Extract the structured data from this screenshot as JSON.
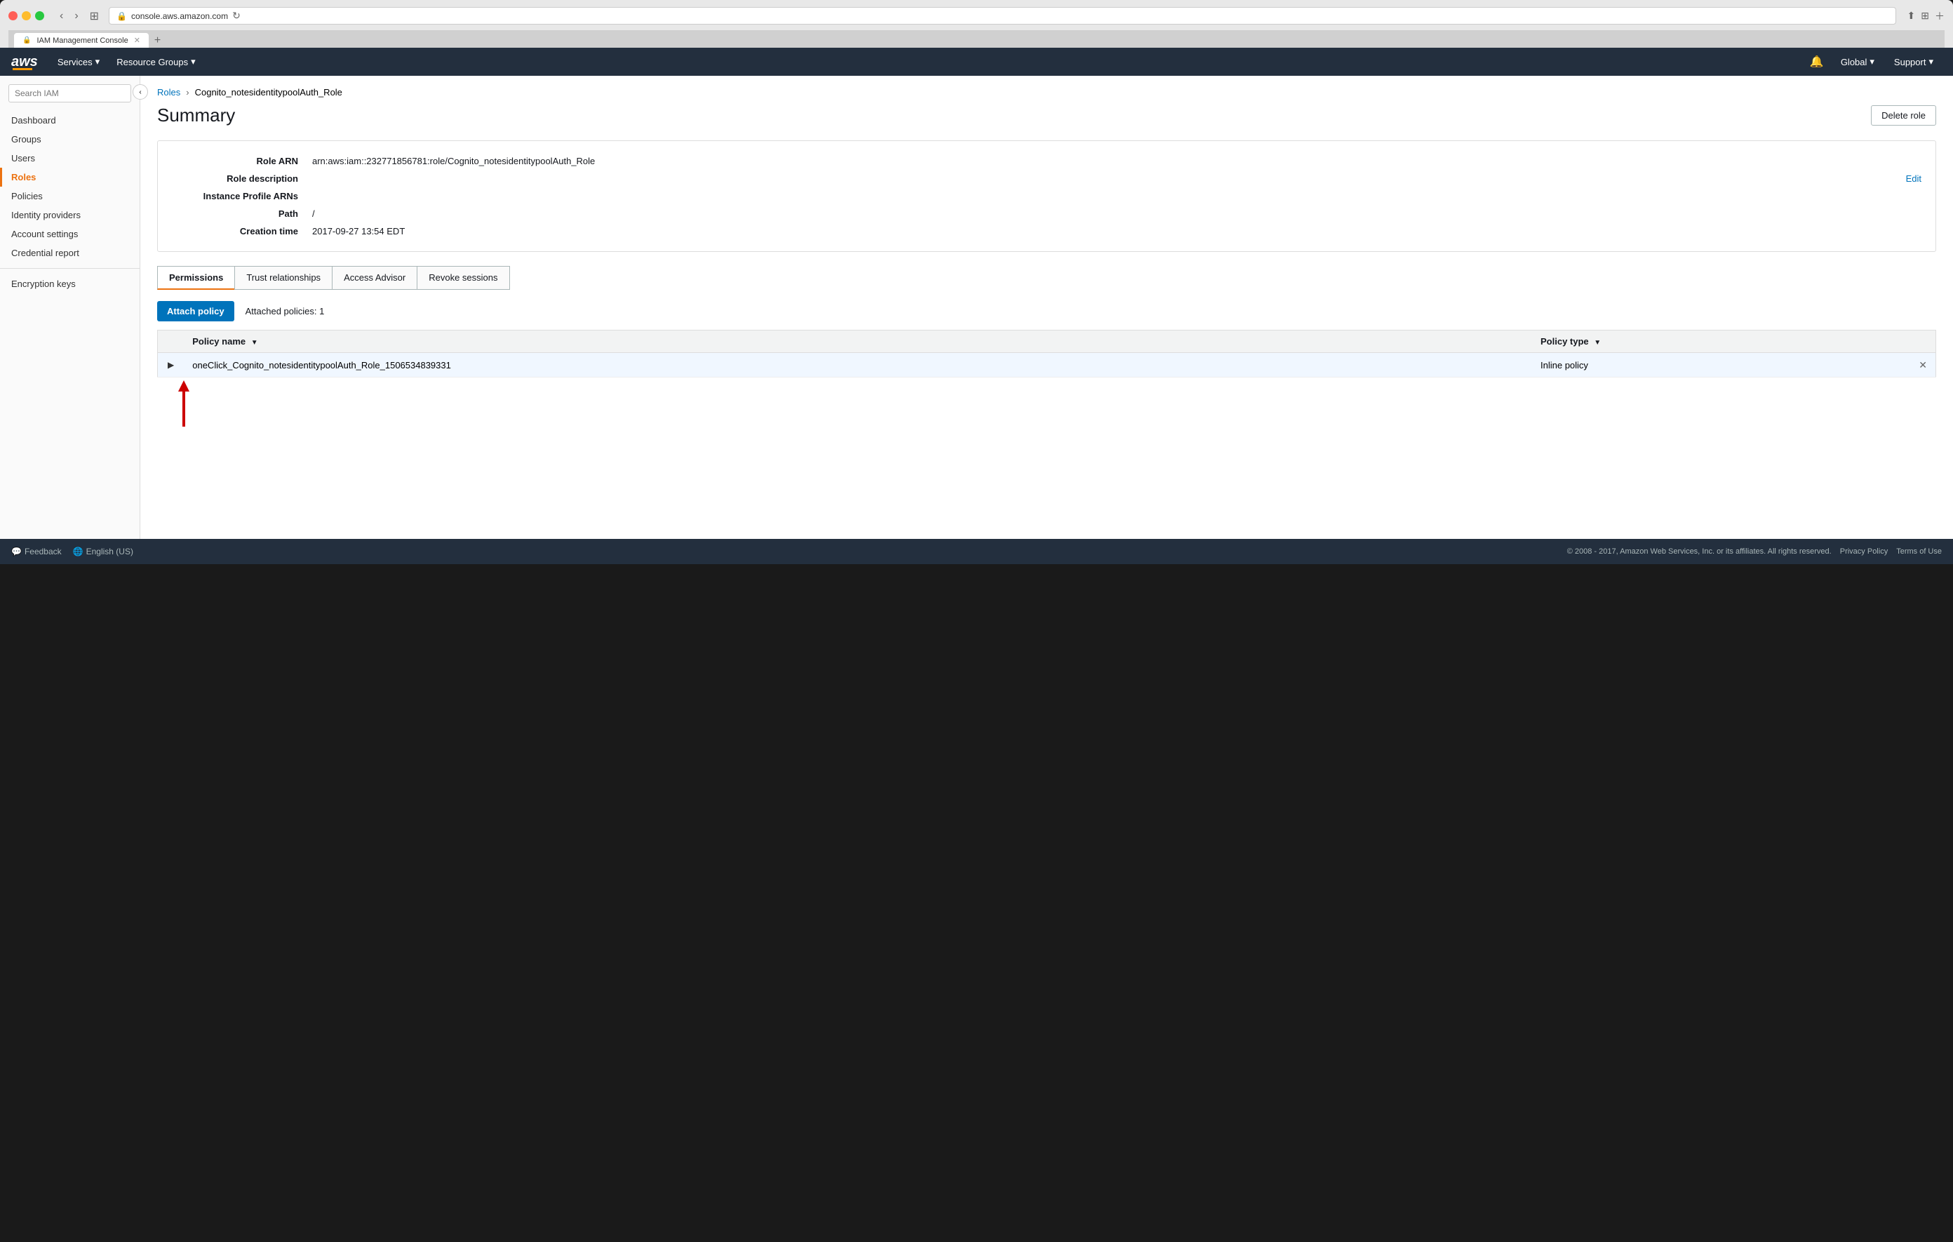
{
  "browser": {
    "url": "console.aws.amazon.com",
    "tab_title": "IAM Management Console",
    "tab_icon": "🔒"
  },
  "aws_nav": {
    "logo": "aws",
    "logo_underline_color": "#ff9900",
    "services_label": "Services",
    "resource_groups_label": "Resource Groups",
    "global_label": "Global",
    "support_label": "Support"
  },
  "sidebar": {
    "search_placeholder": "Search IAM",
    "items": [
      {
        "id": "dashboard",
        "label": "Dashboard",
        "active": false
      },
      {
        "id": "groups",
        "label": "Groups",
        "active": false
      },
      {
        "id": "users",
        "label": "Users",
        "active": false
      },
      {
        "id": "roles",
        "label": "Roles",
        "active": true
      },
      {
        "id": "policies",
        "label": "Policies",
        "active": false
      },
      {
        "id": "identity-providers",
        "label": "Identity providers",
        "active": false
      },
      {
        "id": "account-settings",
        "label": "Account settings",
        "active": false
      },
      {
        "id": "credential-report",
        "label": "Credential report",
        "active": false
      }
    ],
    "bottom_items": [
      {
        "id": "encryption-keys",
        "label": "Encryption keys",
        "active": false
      }
    ]
  },
  "breadcrumb": {
    "parent_label": "Roles",
    "current_label": "Cognito_notesidentitypoolAuth_Role"
  },
  "page": {
    "title": "Summary",
    "delete_button_label": "Delete role"
  },
  "summary": {
    "role_arn_label": "Role ARN",
    "role_arn_value": "arn:aws:iam::232771856781:role/Cognito_notesidentitypoolAuth_Role",
    "role_description_label": "Role description",
    "role_description_value": "",
    "instance_profile_arns_label": "Instance Profile ARNs",
    "instance_profile_arns_value": "",
    "path_label": "Path",
    "path_value": "/",
    "creation_time_label": "Creation time",
    "creation_time_value": "2017-09-27 13:54 EDT",
    "edit_label": "Edit"
  },
  "tabs": [
    {
      "id": "permissions",
      "label": "Permissions",
      "active": true
    },
    {
      "id": "trust-relationships",
      "label": "Trust relationships",
      "active": false
    },
    {
      "id": "access-advisor",
      "label": "Access Advisor",
      "active": false
    },
    {
      "id": "revoke-sessions",
      "label": "Revoke sessions",
      "active": false
    }
  ],
  "policy_section": {
    "attach_button_label": "Attach policy",
    "attached_count_text": "Attached policies: 1",
    "table_headers": [
      {
        "id": "policy-name",
        "label": "Policy name",
        "sortable": true
      },
      {
        "id": "policy-type",
        "label": "Policy type",
        "sortable": true
      }
    ],
    "policies": [
      {
        "name": "oneClick_Cognito_notesidentitypoolAuth_Role_1506534839331",
        "type": "Inline policy",
        "expanded": false
      }
    ]
  },
  "footer": {
    "feedback_label": "Feedback",
    "language_label": "English (US)",
    "copyright_text": "© 2008 - 2017, Amazon Web Services, Inc. or its affiliates. All rights reserved.",
    "privacy_policy_label": "Privacy Policy",
    "terms_label": "Terms of Use"
  }
}
